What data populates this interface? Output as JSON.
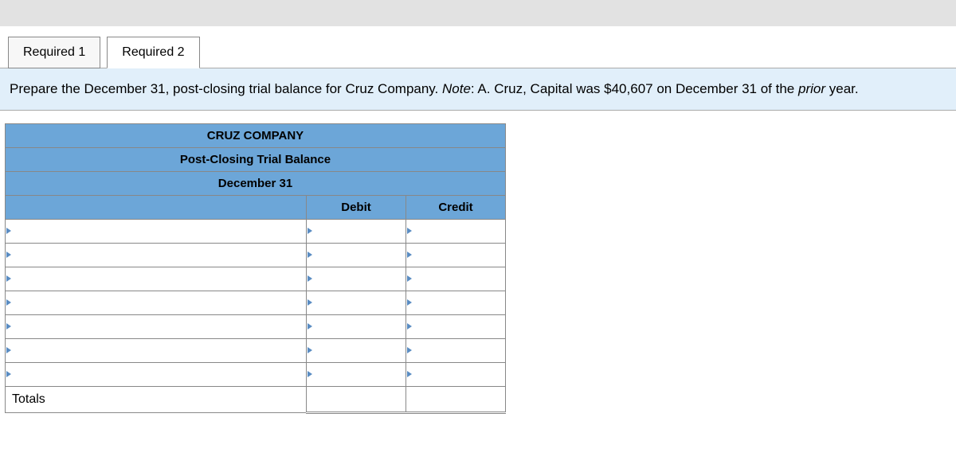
{
  "tabs": [
    {
      "label": "Required 1"
    },
    {
      "label": "Required 2"
    }
  ],
  "instruction": {
    "prefix": "Prepare the December 31, post-closing trial balance for Cruz Company. ",
    "note_label": "Note",
    "note_text": ": A. Cruz, Capital was $40,607 on December 31 of the ",
    "prior": "prior",
    "suffix": " year."
  },
  "worksheet": {
    "company": "CRUZ COMPANY",
    "title": "Post-Closing Trial Balance",
    "date": "December 31",
    "cols": {
      "debit": "Debit",
      "credit": "Credit"
    },
    "totals_label": "Totals"
  }
}
